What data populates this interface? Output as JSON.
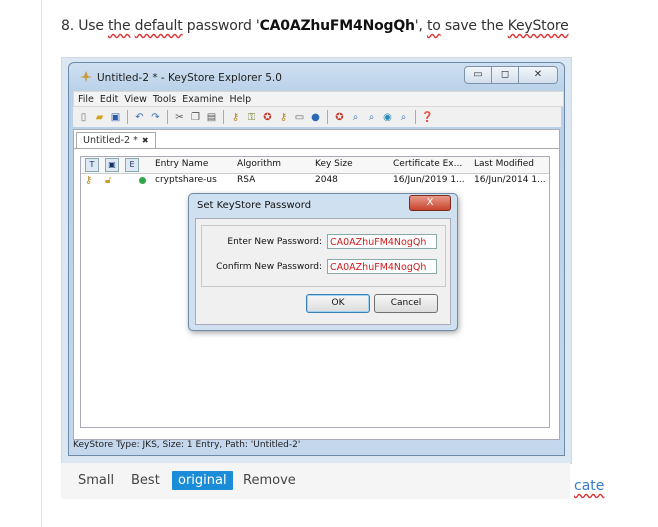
{
  "step_caption": {
    "prefix": "8. Use ",
    "w1": "the",
    "sp1": " ",
    "w2": "default",
    "mid": " password '",
    "password": "CA0AZhuFM4NogQh",
    "middle2": "', ",
    "w3": "to",
    "sp2": " save the ",
    "w4": "KeyStore"
  },
  "window": {
    "title": "Untitled-2 * - KeyStore Explorer 5.0",
    "menu": [
      "File",
      "Edit",
      "View",
      "Tools",
      "Examine",
      "Help"
    ],
    "tab_label": "Untitled-2 *",
    "tab_close": "✖",
    "columns": {
      "col_t": "T",
      "col_e": "E",
      "entry_name": "Entry Name",
      "algorithm": "Algorithm",
      "key_size": "Key Size",
      "cert_expiry": "Certificate Ex...",
      "last_modified": "Last Modified"
    },
    "row": {
      "entry_name": "cryptshare-us",
      "algorithm": "RSA",
      "key_size": "2048",
      "cert_expiry": "16/Jun/2019 1...",
      "last_modified": "16/Jun/2014 1..."
    },
    "status_bar": "KeyStore Type: JKS, Size: 1 Entry, Path: 'Untitled-2'"
  },
  "dialog": {
    "title": "Set KeyStore Password",
    "close_glyph": "X",
    "enter_label": "Enter New Password:",
    "enter_value": "CA0AZhuFM4NogQh",
    "confirm_label": "Confirm New Password:",
    "confirm_value": "CA0AZhuFM4NogQh",
    "ok": "OK",
    "cancel": "Cancel"
  },
  "image_size_options": [
    "Small",
    "Best",
    "original",
    "Remove"
  ],
  "side_link": "cate",
  "colors": {
    "accent": "#1a8cd8",
    "password_text": "#d01a1a"
  }
}
